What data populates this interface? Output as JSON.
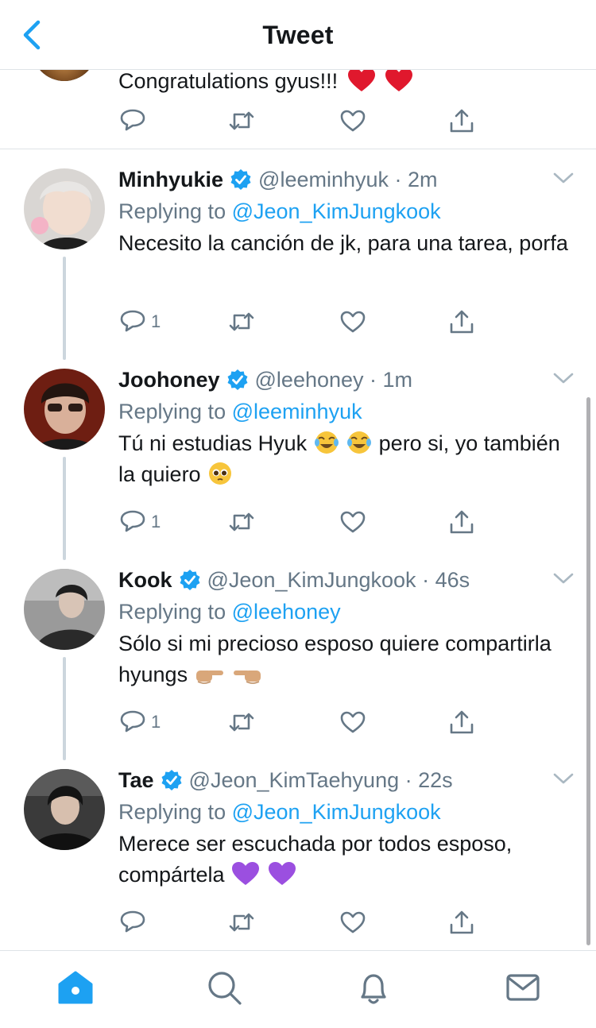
{
  "header": {
    "title": "Tweet",
    "back_icon": "chevron-left-icon"
  },
  "colors": {
    "accent": "#1da1f2",
    "secondary_text": "#657786",
    "verified": "#1da1f2"
  },
  "top_tweet": {
    "text": "Congratulations gyus!!!",
    "emojis": [
      "red-heart",
      "red-heart"
    ]
  },
  "tweets": [
    {
      "name": "Minhyukie",
      "handle": "@leeminhyuk",
      "separator": "·",
      "time": "2m",
      "replying_prefix": "Replying to",
      "replying_to": "@Jeon_KimJungkook",
      "text": "Necesito la canción de jk, para una tarea, porfa",
      "reply_count": "1"
    },
    {
      "name": "Joohoney",
      "handle": "@leehoney",
      "separator": "·",
      "time": "1m",
      "replying_prefix": "Replying to",
      "replying_to": "@leeminhyuk",
      "text_part1": "Tú ni estudias Hyuk",
      "text_part2": "pero si, yo también la quiero",
      "emojis": [
        "tears-of-joy",
        "tears-of-joy",
        "pleading-face"
      ],
      "reply_count": "1"
    },
    {
      "name": "Kook",
      "handle": "@Jeon_KimJungkook",
      "separator": "·",
      "time": "46s",
      "replying_prefix": "Replying to",
      "replying_to": "@leehoney",
      "text": "Sólo si mi precioso esposo quiere compartirla hyungs",
      "emojis": [
        "pointing-right-hand",
        "pointing-left-hand"
      ],
      "reply_count": "1"
    },
    {
      "name": "Tae",
      "handle": "@Jeon_KimTaehyung",
      "separator": "·",
      "time": "22s",
      "replying_prefix": "Replying to",
      "replying_to": "@Jeon_KimJungkook",
      "text": "Merece ser escuchada por todos esposo, compártela",
      "emojis": [
        "purple-heart",
        "purple-heart"
      ],
      "reply_count": ""
    }
  ],
  "tabbar": [
    "home-icon",
    "search-icon",
    "notifications-icon",
    "messages-icon"
  ]
}
